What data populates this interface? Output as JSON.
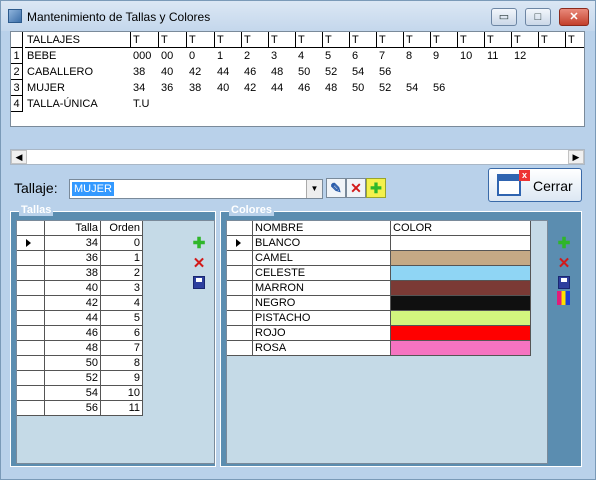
{
  "window": {
    "title": "Mantenimiento de Tallas y Colores",
    "controls": {
      "minimize": "▭",
      "maximize": "□",
      "close": "✕"
    }
  },
  "tallajes_grid": {
    "headers": [
      "TALLAJES",
      "T",
      "T",
      "T",
      "T",
      "T",
      "T",
      "T",
      "T",
      "T",
      "T",
      "T",
      "T",
      "T",
      "T",
      "T",
      "T",
      "T",
      "T",
      "T"
    ],
    "rows": [
      {
        "num": "1",
        "name": "BEBE",
        "values": [
          "000",
          "00",
          "0",
          "1",
          "2",
          "3",
          "4",
          "5",
          "6",
          "7",
          "8",
          "9",
          "10",
          "11",
          "12"
        ]
      },
      {
        "num": "2",
        "name": "CABALLERO",
        "values": [
          "38",
          "40",
          "42",
          "44",
          "46",
          "48",
          "50",
          "52",
          "54",
          "56"
        ]
      },
      {
        "num": "3",
        "name": "MUJER",
        "values": [
          "34",
          "36",
          "38",
          "40",
          "42",
          "44",
          "46",
          "48",
          "50",
          "52",
          "54",
          "56"
        ]
      },
      {
        "num": "4",
        "name": "TALLA-ÚNICA",
        "values": [
          "T.U"
        ]
      }
    ]
  },
  "tallaje_selector": {
    "label": "Tallaje:",
    "value": "MUJER"
  },
  "cerrar_button": {
    "label": "Cerrar"
  },
  "tallas_group": {
    "title": "Tallas",
    "headers": [
      "Talla",
      "Orden"
    ],
    "rows": [
      [
        "34",
        "0"
      ],
      [
        "36",
        "1"
      ],
      [
        "38",
        "2"
      ],
      [
        "40",
        "3"
      ],
      [
        "42",
        "4"
      ],
      [
        "44",
        "5"
      ],
      [
        "46",
        "6"
      ],
      [
        "48",
        "7"
      ],
      [
        "50",
        "8"
      ],
      [
        "52",
        "9"
      ],
      [
        "54",
        "10"
      ],
      [
        "56",
        "11"
      ]
    ]
  },
  "colores_group": {
    "title": "Colores",
    "headers": [
      "NOMBRE",
      "COLOR"
    ],
    "rows": [
      {
        "name": "BLANCO",
        "color": "#ffffff"
      },
      {
        "name": "CAMEL",
        "color": "#c5a985"
      },
      {
        "name": "CELESTE",
        "color": "#8fd5f4"
      },
      {
        "name": "MARRON",
        "color": "#7b3a35"
      },
      {
        "name": "NEGRO",
        "color": "#101010"
      },
      {
        "name": "PISTACHO",
        "color": "#d2f57e"
      },
      {
        "name": "ROJO",
        "color": "#ff0000"
      },
      {
        "name": "ROSA",
        "color": "#f673c1"
      }
    ]
  },
  "icons": {
    "add": "plus-icon",
    "delete": "x-icon",
    "save": "disk-icon",
    "edit": "edit-icon",
    "palette": "palette-icon"
  },
  "colors": {
    "window_bg": "#b9d1ea",
    "group_bg": "#5b8db0",
    "grid_bg": "#c5dae7",
    "selection": "#3399ff"
  }
}
